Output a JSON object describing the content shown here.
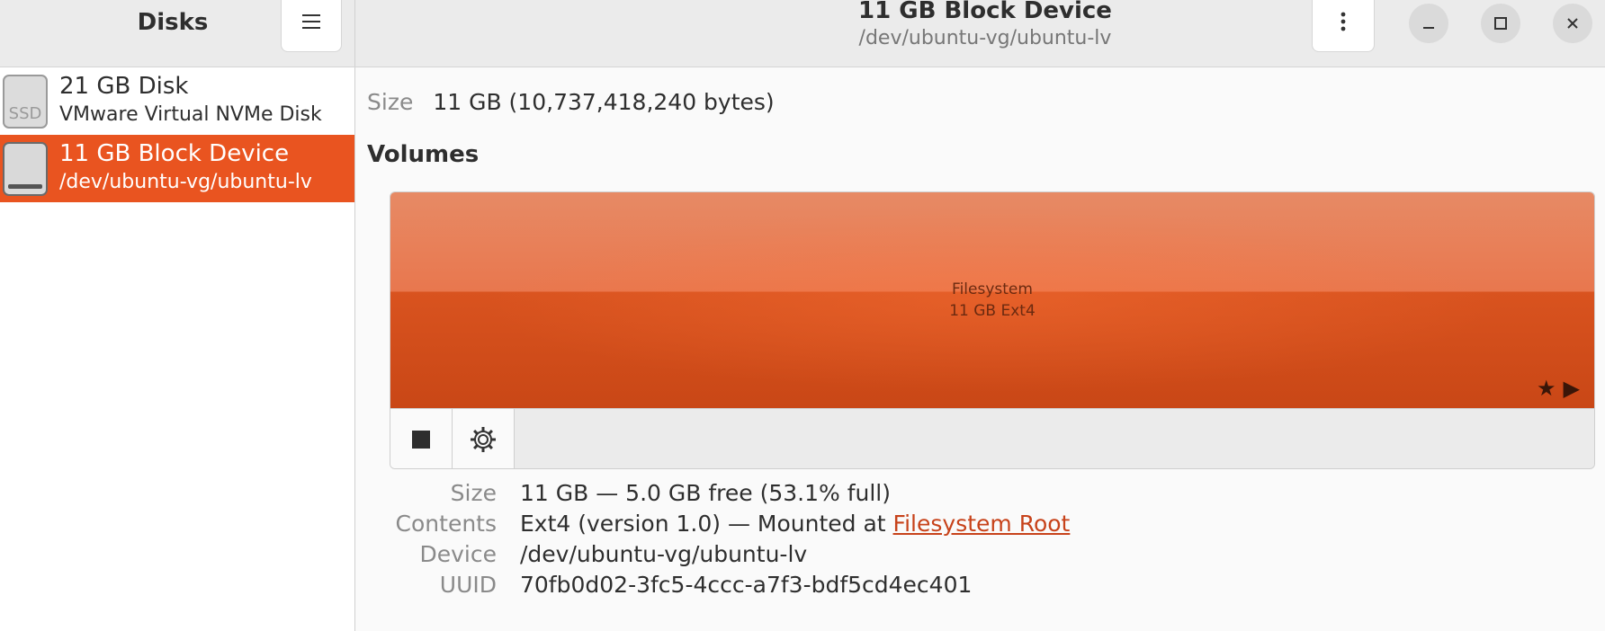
{
  "header": {
    "app_title": "Disks",
    "menu_icon": "hamburger-menu-icon",
    "device_title": "11 GB Block Device",
    "device_subtitle": "/dev/ubuntu-vg/ubuntu-lv",
    "more_icon": "vertical-dots-icon",
    "window_controls": {
      "minimize": "–",
      "maximize": "□",
      "close": "✕"
    }
  },
  "sidebar": {
    "items": [
      {
        "title": "21 GB Disk",
        "subtitle": "VMware Virtual NVMe Disk",
        "icon": "ssd-icon",
        "icon_text": "SSD",
        "selected": false
      },
      {
        "title": "11 GB Block Device",
        "subtitle": "/dev/ubuntu-vg/ubuntu-lv",
        "icon": "block-device-icon",
        "selected": true
      }
    ]
  },
  "main": {
    "size_label": "Size",
    "size_value": "11 GB (10,737,418,240 bytes)",
    "volumes_heading": "Volumes",
    "partition": {
      "line1": "Filesystem",
      "line2": "11 GB Ext4",
      "icons": "★▶",
      "fill_color": "#e95420"
    },
    "toolbar": {
      "stop_icon": "stop-icon",
      "settings_icon": "gear-icon"
    },
    "details": {
      "size_label": "Size",
      "size_value": "11 GB — 5.0 GB free (53.1% full)",
      "contents_label": "Contents",
      "contents_value": "Ext4 (version 1.0) — Mounted at ",
      "contents_link": "Filesystem Root",
      "device_label": "Device",
      "device_value": "/dev/ubuntu-vg/ubuntu-lv",
      "uuid_label": "UUID",
      "uuid_value": "70fb0d02-3fc5-4ccc-a7f3-bdf5cd4ec401"
    }
  },
  "colors": {
    "accent": "#e95420",
    "link": "#c7421a"
  }
}
